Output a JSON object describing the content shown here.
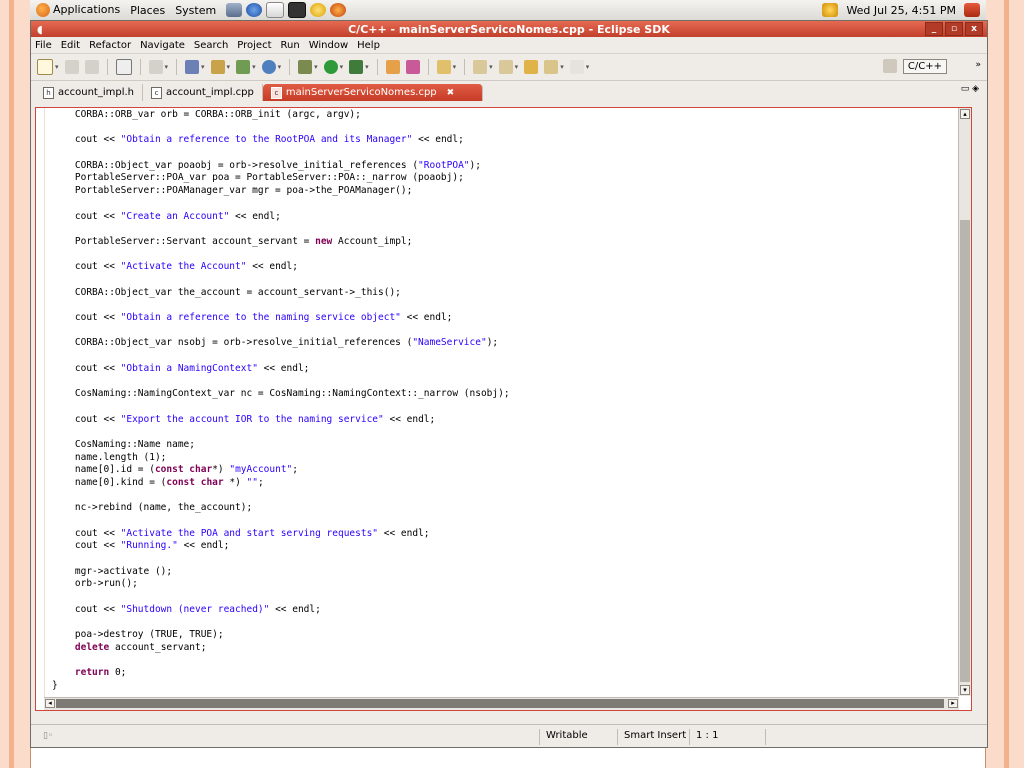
{
  "gnome_panel": {
    "menus": [
      "Applications",
      "Places",
      "System"
    ],
    "datetime": "Wed Jul 25,  4:51 PM"
  },
  "window": {
    "title": "C/C++ - mainServerServicoNomes.cpp - Eclipse SDK",
    "controls": [
      "_",
      "▫",
      "x"
    ]
  },
  "menubar": [
    "File",
    "Edit",
    "Refactor",
    "Navigate",
    "Search",
    "Project",
    "Run",
    "Window",
    "Help"
  ],
  "toolbar": {
    "perspective_label": "C/C++",
    "overflow": "»"
  },
  "tabs": [
    {
      "label": "account_impl.h",
      "active": false
    },
    {
      "label": "account_impl.cpp",
      "active": false
    },
    {
      "label": "mainServerServicoNomes.cpp",
      "active": true
    }
  ],
  "editor": {
    "lines": [
      "    CORBA::ORB_var orb = CORBA::ORB_init (argc, argv);",
      "",
      "    cout << \"Obtain a reference to the RootPOA and its Manager\" << endl;",
      "",
      "    CORBA::Object_var poaobj = orb->resolve_initial_references (\"RootPOA\");",
      "    PortableServer::POA_var poa = PortableServer::POA::_narrow (poaobj);",
      "    PortableServer::POAManager_var mgr = poa->the_POAManager();",
      "",
      "    cout << \"Create an Account\" << endl;",
      "",
      "    PortableServer::Servant account_servant = new Account_impl;",
      "",
      "    cout << \"Activate the Account\" << endl;",
      "",
      "    CORBA::Object_var the_account = account_servant->_this();",
      "",
      "    cout << \"Obtain a reference to the naming service object\" << endl;",
      "",
      "    CORBA::Object_var nsobj = orb->resolve_initial_references (\"NameService\");",
      "",
      "    cout << \"Obtain a NamingContext\" << endl;",
      "",
      "    CosNaming::NamingContext_var nc = CosNaming::NamingContext::_narrow (nsobj);",
      "",
      "    cout << \"Export the account IOR to the naming service\" << endl;",
      "",
      "    CosNaming::Name name;",
      "    name.length (1);",
      "    name[0].id = (const char*) \"myAccount\";",
      "    name[0].kind = (const char *) \"\";",
      "",
      "    nc->rebind (name, the_account);",
      "",
      "    cout << \"Activate the POA and start serving requests\" << endl;",
      "    cout << \"Running.\" << endl;",
      "",
      "    mgr->activate ();",
      "    orb->run();",
      "",
      "    cout << \"Shutdown (never reached)\" << endl;",
      "",
      "    poa->destroy (TRUE, TRUE);",
      "    delete account_servant;",
      "",
      "    return 0;",
      "}"
    ],
    "vertical_scroll_position": 0.98
  },
  "statusbar": {
    "mode": "Writable",
    "insert_mode": "Smart Insert",
    "position": "1 : 1"
  }
}
